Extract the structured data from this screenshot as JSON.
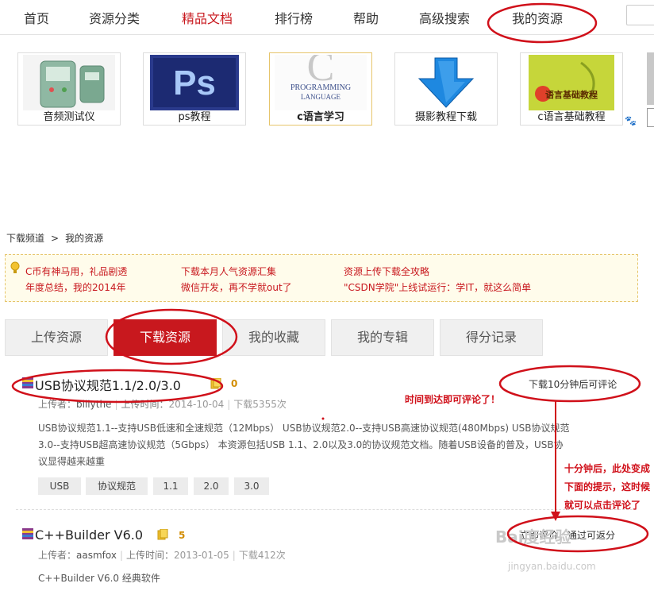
{
  "nav": {
    "items": [
      {
        "label": "首页"
      },
      {
        "label": "资源分类"
      },
      {
        "label": "精品文档"
      },
      {
        "label": "排行榜"
      },
      {
        "label": "帮助"
      },
      {
        "label": "高级搜索"
      },
      {
        "label": "我的资源"
      }
    ],
    "active_index": 2
  },
  "ads": [
    {
      "label": "音频测试仪",
      "icon": "tester-device-icon"
    },
    {
      "label": "ps教程",
      "icon": "photoshop-logo-icon"
    },
    {
      "label": "c语言学习",
      "icon": "c-programming-book-icon",
      "thumb_text_1": "C",
      "thumb_text_2": "PROGRAMMING",
      "thumb_text_3": "LANGUAGE"
    },
    {
      "label": "摄影教程下载",
      "icon": "blue-download-arrow-icon"
    },
    {
      "label": "c语言基础教程",
      "icon": "c-basics-book-icon",
      "thumb_text_1": "语言基础教程"
    }
  ],
  "breadcrumb": {
    "root": "下载频道",
    "separator": ">",
    "current": "我的资源"
  },
  "notice": {
    "links": [
      "C币有神马用，礼品剧透",
      "年度总结，我的2014年",
      "下载本月人气资源汇集",
      "微信开发，再不学就out了",
      "资源上传下载全攻略",
      "\"CSDN学院\"上线试运行：学IT，就这么简单"
    ]
  },
  "tabs": [
    {
      "label": "上传资源"
    },
    {
      "label": "下载资源"
    },
    {
      "label": "我的收藏"
    },
    {
      "label": "我的专辑"
    },
    {
      "label": "得分记录"
    }
  ],
  "resources": [
    {
      "title": "USB协议规范1.1/2.0/3.0",
      "score": "0",
      "uploader_label": "上传者：",
      "uploader": "billythe",
      "upload_time_label": "上传时间：",
      "upload_time": "2014-10-04",
      "downloads": "下载5355次",
      "description_1": "USB协议规范1.1--支持USB低速和全速规范（12Mbps） USB协议规范2.0--支持USB高速协议规范(480Mbps) USB协议规范",
      "description_2": "3.0--支持USB超高速协议规范（5Gbps） 本资源包括USB 1.1、2.0以及3.0的协议规范文档。随着USB设备的普及，USB协",
      "description_3": "议显得越来越重",
      "tags": [
        "USB",
        "协议规范",
        "1.1",
        "2.0",
        "3.0"
      ],
      "action": "下载10分钟后可评论"
    },
    {
      "title": "C++Builder V6.0",
      "score": "5",
      "uploader_label": "上传者：",
      "uploader": "aasmfox",
      "upload_time_label": "上传时间：",
      "upload_time": "2013-01-05",
      "downloads": "下载412次",
      "description_1": "C++Builder V6.0 经典软件",
      "action": "立即评价，通过可返分"
    }
  ],
  "annotations": {
    "note_1": "时间到达即可评论了！",
    "note_2_line_1": "十分钟后，此处变成",
    "note_2_line_2": "下面的提示，这时候",
    "note_2_line_3": "就可以点击评论了"
  },
  "watermark": {
    "main": "Bai度经验",
    "sub": "jingyan.baidu.com"
  },
  "colors": {
    "brand_red": "#c8181e",
    "annotation_red": "#d0101a",
    "notice_bg": "#fffceb",
    "score_gold": "#d28c00"
  }
}
